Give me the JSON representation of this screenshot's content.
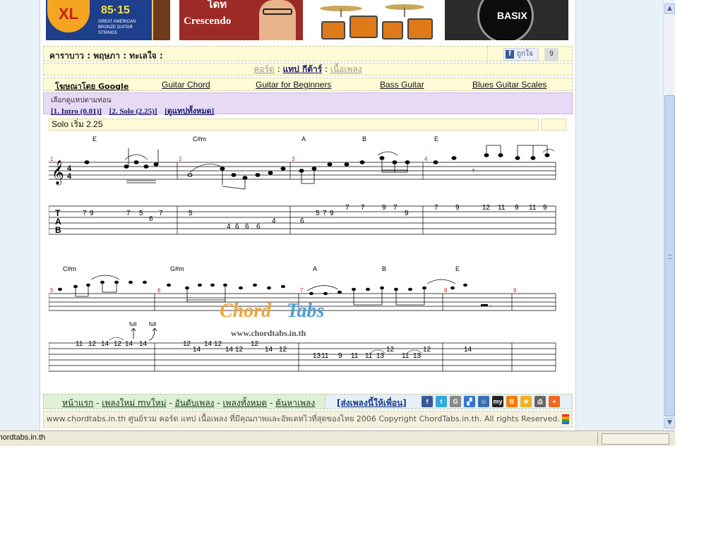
{
  "ads": {
    "ad1": {
      "logo": "XL",
      "strings_text": "85·15",
      "sub_text": "GREAT AMERICAN BRONZE GUITAR STRINGS"
    },
    "ad2": {
      "top_text": "ไดท",
      "title": "Crescendo"
    },
    "ad4": {
      "brand": "BASIX"
    }
  },
  "song": {
    "title": "คาราบาว : พฤษภา : ทะเลใจ :",
    "like_label": "ถูกใจ",
    "like_count": "9"
  },
  "nav": {
    "chord": "คอร์ด",
    "sep1": ":",
    "tab": "แทป กีต้าร์",
    "sep2": ":",
    "lyrics": "เนื้อเพลง"
  },
  "links": [
    {
      "label": "โฆษณาโดย Google",
      "bold": true
    },
    {
      "label": "Guitar Chord"
    },
    {
      "label": "Guitar for Beginners"
    },
    {
      "label": "Bass Guitar"
    },
    {
      "label": "Blues Guitar Scales"
    }
  ],
  "jump": {
    "label": "เลือกดูแทปตามท่อน",
    "items": [
      "[1. Intro (0.01)]",
      "[2. Solo (2.25)]",
      "[ดูแทปทั้งหมด]"
    ]
  },
  "section": {
    "name": "Solo",
    "start": "เริ่ม 2.25"
  },
  "tab_line_1": {
    "chords": [
      "E",
      "C#m",
      "A",
      "B",
      "E"
    ],
    "measure_numbers": [
      "1",
      "2",
      "3",
      "4"
    ],
    "time_sig_top": "4",
    "time_sig_bottom": "4",
    "tab_clef": [
      "T",
      "A",
      "B"
    ],
    "frets": [
      "7",
      "9",
      "7",
      "5",
      "7",
      "6",
      "5",
      "4",
      "6",
      "6",
      "6",
      "4",
      "6",
      "5",
      "7",
      "9",
      "7",
      "7",
      "9",
      "7",
      "9",
      "7",
      "9",
      "12",
      "11",
      "9",
      "11",
      "9"
    ]
  },
  "tab_line_2": {
    "chords": [
      "C#m",
      "G#m",
      "A",
      "B",
      "E"
    ],
    "measure_numbers": [
      "5",
      "6",
      "7",
      "8",
      "9"
    ],
    "bend_labels": [
      "full",
      "full"
    ],
    "frets": [
      "11",
      "12",
      "14",
      "12",
      "14",
      "14",
      "12",
      "14",
      "14",
      "12",
      "14",
      "12",
      "12",
      "14",
      "12",
      "13",
      "11",
      "9",
      "11",
      "11",
      "13",
      "12",
      "11",
      "13",
      "12",
      "14"
    ]
  },
  "watermark": {
    "chord": "Chord",
    "tabs": "Tabs",
    "url": "www.chordtabs.in.th"
  },
  "footer": {
    "links": [
      "หน้าแรก",
      "เพลงใหม่ mvใหม่",
      "อันดับเพลง",
      "เพลงทั้งหมด",
      "ค้นหาเพลง"
    ],
    "separator": "-",
    "share_label": "[ส่งเพลงนี้ให้เพื่อน]",
    "share_icons": [
      {
        "name": "facebook-share-icon",
        "glyph": "f",
        "color": "#3b5998"
      },
      {
        "name": "twitter-share-icon",
        "glyph": "t",
        "color": "#33aadd"
      },
      {
        "name": "google-bookmark-icon",
        "glyph": "G",
        "color": "#8a8a8a"
      },
      {
        "name": "delicious-icon",
        "glyph": "▞",
        "color": "#3274d1"
      },
      {
        "name": "myspace-person-icon",
        "glyph": "☺",
        "color": "#3a6fb5"
      },
      {
        "name": "myspace-icon",
        "glyph": "my",
        "color": "#222222"
      },
      {
        "name": "blogger-icon",
        "glyph": "B",
        "color": "#f57d00"
      },
      {
        "name": "favorites-star-icon",
        "glyph": "★",
        "color": "#f2b01e"
      },
      {
        "name": "print-icon",
        "glyph": "⎙",
        "color": "#666666"
      },
      {
        "name": "more-plus-icon",
        "glyph": "+",
        "color": "#f26522"
      }
    ],
    "copyright": "www.chordtabs.in.th ศูนย์รวม คอร์ด แทป เนื้อเพลง ที่มีคุณภาพและอัพเดทไวที่สุดของไทย 2006 Copyright ChordTabs.in.th. All rights Reserved."
  },
  "statusbar": {
    "url": "chordtabs.in.th"
  },
  "colors": {
    "yellow_row": "#fffbd6",
    "purple_row": "#e8d9f5",
    "green_row": "#dff0d6",
    "link_dark": "#1a1a6e"
  }
}
